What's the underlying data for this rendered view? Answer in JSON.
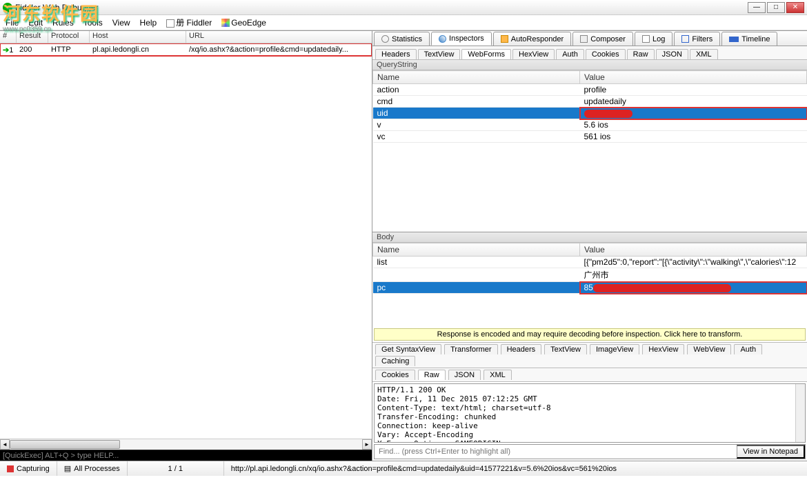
{
  "window": {
    "title": "Fiddler Web Debugger"
  },
  "watermark": {
    "text": "河东软件园",
    "url": "www.pc0359.cn"
  },
  "winbtns": {
    "min": "—",
    "max": "□",
    "close": "✕"
  },
  "menu": {
    "file": "File",
    "edit": "Edit",
    "rules": "Rules",
    "tools": "Tools",
    "view": "View",
    "help": "Help",
    "fiddler": "册 Fiddler",
    "geoedge": "GeoEdge"
  },
  "sessions": {
    "headers": {
      "num": "#",
      "result": "Result",
      "protocol": "Protocol",
      "host": "Host",
      "url": "URL"
    },
    "rows": [
      {
        "num": "1",
        "result": "200",
        "protocol": "HTTP",
        "host": "pl.api.ledongli.cn",
        "url": "/xq/io.ashx?&action=profile&cmd=updatedaily..."
      }
    ]
  },
  "quickexec": "[QuickExec] ALT+Q > type HELP...",
  "tabs_top": {
    "statistics": "Statistics",
    "inspectors": "Inspectors",
    "autoresponder": "AutoResponder",
    "composer": "Composer",
    "log": "Log",
    "filters": "Filters",
    "timeline": "Timeline"
  },
  "req_tabs": {
    "headers": "Headers",
    "textview": "TextView",
    "webforms": "WebForms",
    "hexview": "HexView",
    "auth": "Auth",
    "cookies": "Cookies",
    "raw": "Raw",
    "json": "JSON",
    "xml": "XML"
  },
  "querystring": {
    "title": "QueryString",
    "th_name": "Name",
    "th_value": "Value",
    "rows": [
      {
        "name": "action",
        "value": "profile"
      },
      {
        "name": "cmd",
        "value": "updatedaily"
      },
      {
        "name": "uid",
        "value": ""
      },
      {
        "name": "v",
        "value": "5.6 ios"
      },
      {
        "name": "vc",
        "value": "561 ios"
      }
    ]
  },
  "bodypanel": {
    "title": "Body",
    "th_name": "Name",
    "th_value": "Value",
    "rows": [
      {
        "name": "list",
        "value": "[{\"pm2d5\":0,\"report\":\"[{\\\"activity\\\":\\\"walking\\\",\\\"calories\\\":12"
      },
      {
        "name": "",
        "value": "广州市"
      },
      {
        "name": "pc",
        "value": "85"
      }
    ]
  },
  "notice": "Response is encoded and may require decoding before inspection. Click here to transform.",
  "resp_tabs": {
    "getsyntax": "Get SyntaxView",
    "transformer": "Transformer",
    "headers": "Headers",
    "textview": "TextView",
    "imageview": "ImageView",
    "hexview": "HexView",
    "webview": "WebView",
    "auth": "Auth",
    "caching": "Caching",
    "cookies": "Cookies",
    "raw": "Raw",
    "json": "JSON",
    "xml": "XML"
  },
  "raw_response": "HTTP/1.1 200 OK\nDate: Fri, 11 Dec 2015 07:12:25 GMT\nContent-Type: text/html; charset=utf-8\nTransfer-Encoding: chunked\nConnection: keep-alive\nVary: Accept-Encoding\nX-Frame-Options: SAMEORIGIN",
  "find": {
    "placeholder": "Find... (press Ctrl+Enter to highlight all)",
    "button": "View in Notepad"
  },
  "status": {
    "capturing": "Capturing",
    "processes": "All Processes",
    "count": "1 / 1",
    "url": "http://pl.api.ledongli.cn/xq/io.ashx?&action=profile&cmd=updatedaily&uid=41577221&v=5.6%20ios&vc=561%20ios"
  }
}
